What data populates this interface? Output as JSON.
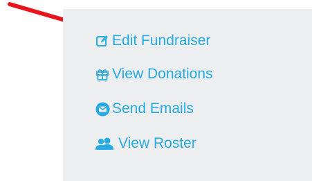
{
  "menu": {
    "items": [
      {
        "label": "Edit Fundraiser",
        "icon": "edit-icon"
      },
      {
        "label": "View Donations",
        "icon": "gift-icon"
      },
      {
        "label": "Send Emails",
        "icon": "envelope-icon"
      },
      {
        "label": "View Roster",
        "icon": "users-icon"
      }
    ]
  },
  "colors": {
    "link": "#25aae1",
    "panel_background": "#eceef0",
    "arrow": "#e8141e"
  }
}
